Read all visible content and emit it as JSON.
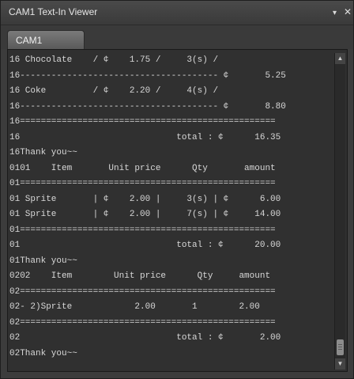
{
  "window": {
    "title": "CAM1 Text-In Viewer",
    "dropdown_glyph": "▾",
    "close_glyph": "✕"
  },
  "tabs": [
    {
      "label": "CAM1"
    }
  ],
  "lines": [
    "16 Chocolate    / ¢    1.75 /     3(s) /",
    "16-------------------------------------- ¢       5.25",
    "16 Coke         / ¢    2.20 /     4(s) /",
    "16-------------------------------------- ¢       8.80",
    "16=================================================",
    "16                              total : ¢      16.35",
    "16Thank you~~",
    "0101    Item       Unit price      Qty       amount",
    "01=================================================",
    "01 Sprite       | ¢    2.00 |     3(s) | ¢      6.00",
    "01 Sprite       | ¢    2.00 |     7(s) | ¢     14.00",
    "01=================================================",
    "01                              total : ¢      20.00",
    "01Thank you~~",
    "0202    Item        Unit price      Qty     amount",
    "02=================================================",
    "02- 2)Sprite            2.00       1        2.00",
    "02=================================================",
    "02                              total : ¢       2.00",
    "02Thank you~~"
  ],
  "scrollbar": {
    "up_glyph": "▲",
    "down_glyph": "▼"
  }
}
